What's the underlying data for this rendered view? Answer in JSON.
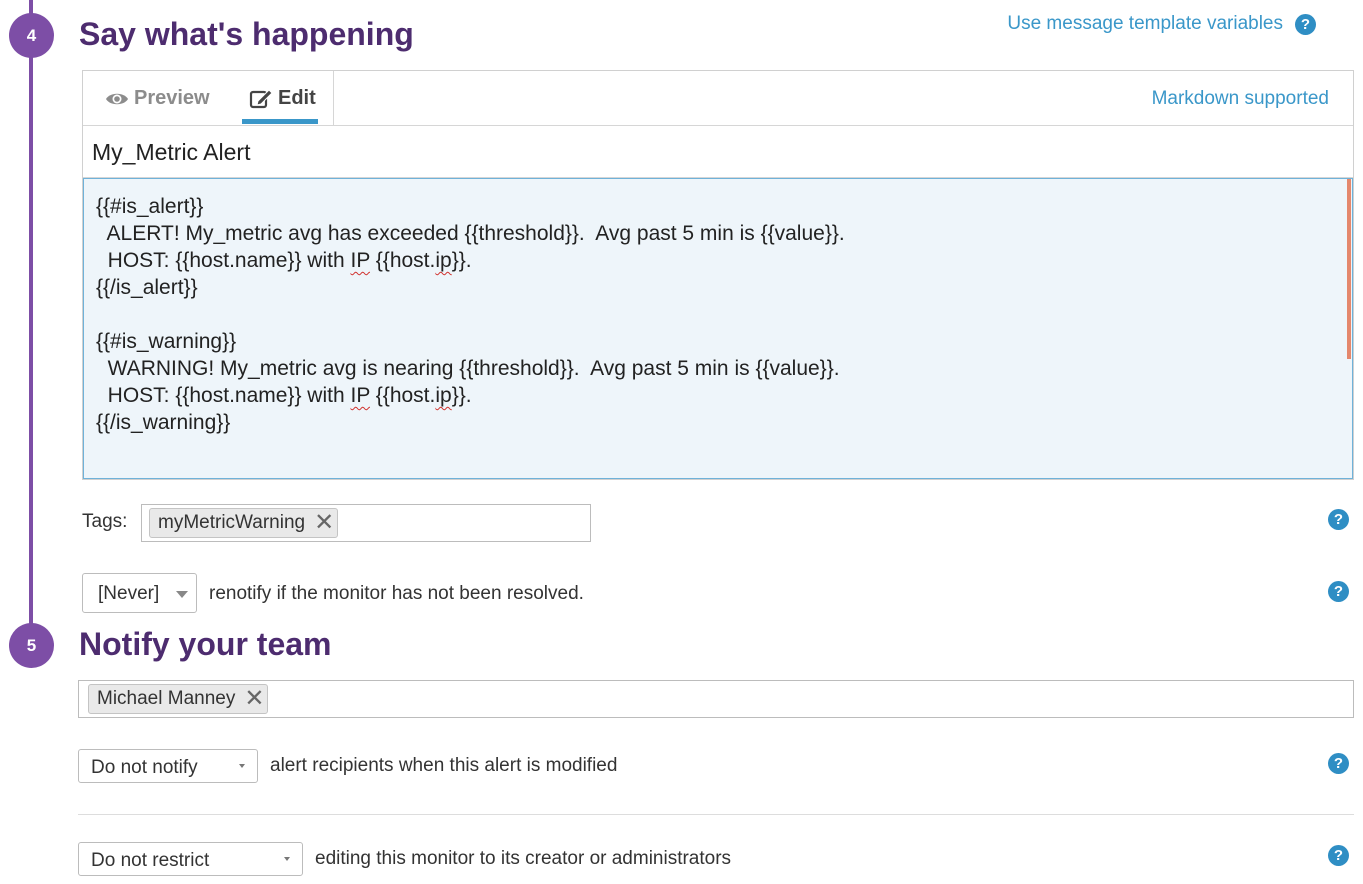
{
  "steps": {
    "say": {
      "number": "4",
      "title": "Say what's happening"
    },
    "notify": {
      "number": "5",
      "title": "Notify your team"
    }
  },
  "template_variables_link": "Use message template variables",
  "help_glyph": "?",
  "editor": {
    "tabs": [
      {
        "label": "Preview",
        "icon": "eye-icon",
        "active": false
      },
      {
        "label": "Edit",
        "icon": "pencil-square-icon",
        "active": true
      }
    ],
    "markdown_link": "Markdown supported",
    "subject": "My_Metric Alert",
    "body_lines": [
      "{{#is_alert}}",
      "  ALERT! My_metric avg has exceeded {{threshold}}.  Avg past 5 min is {{value}}.",
      "  HOST: {{host.name}} with IP {{host.ip}}.",
      "{{/is_alert}}",
      "",
      "{{#is_warning}}",
      "  WARNING! My_metric avg is nearing {{threshold}}.  Avg past 5 min is {{value}}.",
      "  HOST: {{host.name}} with IP {{host.ip}}.",
      "{{/is_warning}}"
    ]
  },
  "tags": {
    "label": "Tags:",
    "items": [
      "myMetricWarning"
    ],
    "remove_glyph": "✕"
  },
  "renotify": {
    "selected": "[Never]",
    "text": "renotify if the monitor has not been resolved."
  },
  "team": {
    "recipients": [
      "Michael Manney"
    ]
  },
  "modified_notify": {
    "selected": "Do not notify",
    "text": "alert recipients when this alert is modified"
  },
  "restrict": {
    "selected": "Do not restrict",
    "text": "editing this monitor to its creator or administrators"
  },
  "colors": {
    "accent_purple": "#7d4ea6",
    "title_purple": "#4d2c6f",
    "link_blue": "#3a97c9",
    "help_blue": "#2f8ec4"
  }
}
